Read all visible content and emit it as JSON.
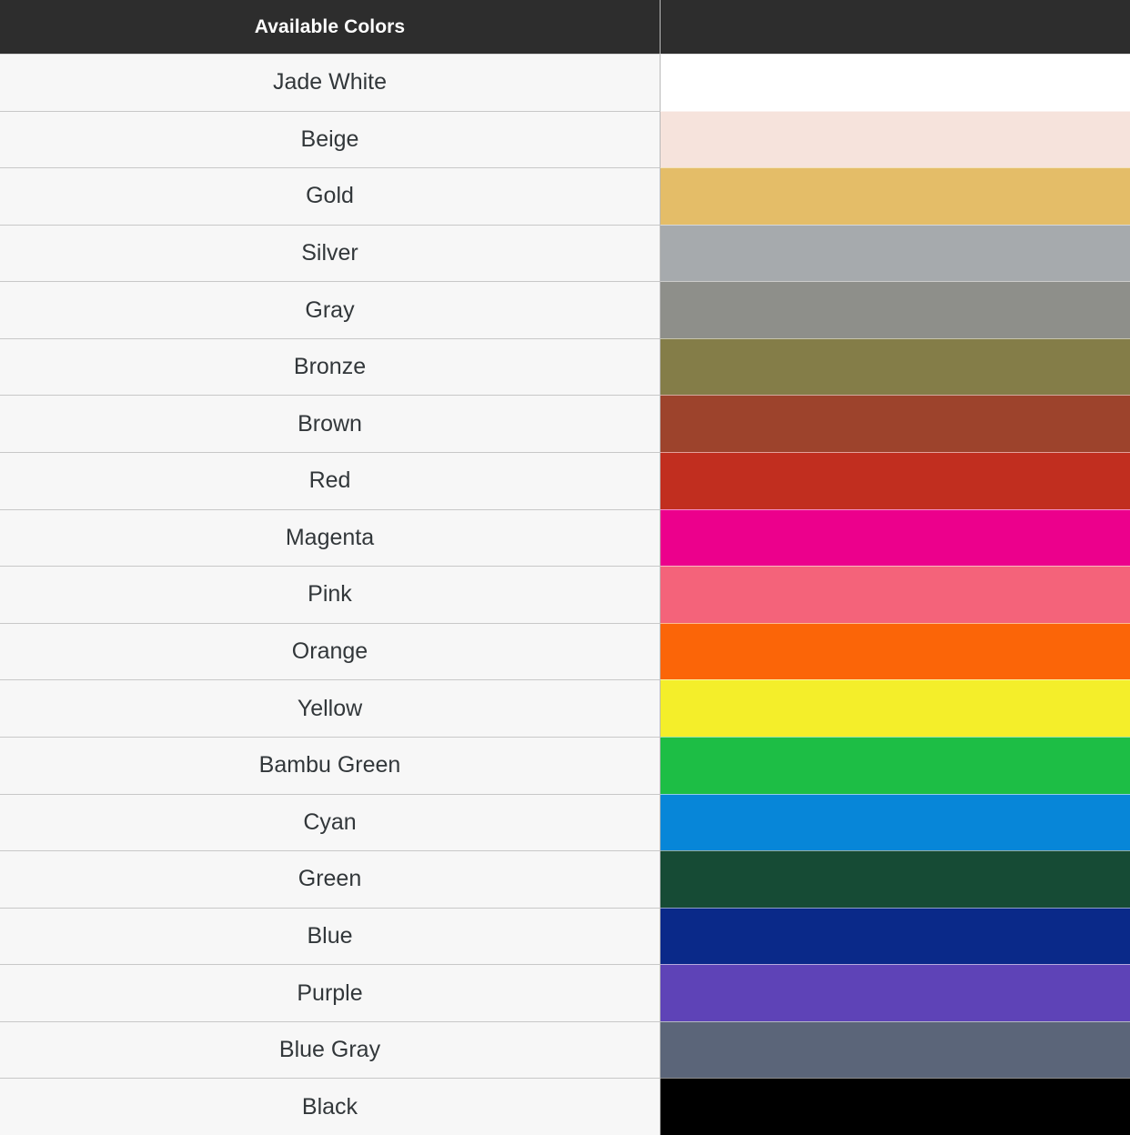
{
  "table": {
    "header": {
      "name_column_label": "Available Colors",
      "swatch_column_label": "",
      "background": "#2d2d2d",
      "text_color": "#ffffff"
    },
    "name_column_background": "#f7f7f7",
    "name_text_color": "#32373a",
    "divider_color": "#c8c8c8",
    "rows": [
      {
        "name": "Jade White",
        "swatch": "#ffffff"
      },
      {
        "name": "Beige",
        "swatch": "#f6e3dc"
      },
      {
        "name": "Gold",
        "swatch": "#e4bd68"
      },
      {
        "name": "Silver",
        "swatch": "#a6aaad"
      },
      {
        "name": "Gray",
        "swatch": "#8e8f8a"
      },
      {
        "name": "Bronze",
        "swatch": "#847d48"
      },
      {
        "name": "Brown",
        "swatch": "#9d432c"
      },
      {
        "name": "Red",
        "swatch": "#c12e1f"
      },
      {
        "name": "Magenta",
        "swatch": "#ec008c"
      },
      {
        "name": "Pink",
        "swatch": "#f4637a"
      },
      {
        "name": "Orange",
        "swatch": "#fb6508"
      },
      {
        "name": "Yellow",
        "swatch": "#f4ee2a"
      },
      {
        "name": "Bambu Green",
        "swatch": "#1dbe45"
      },
      {
        "name": "Cyan",
        "swatch": "#0786d8"
      },
      {
        "name": "Green",
        "swatch": "#164b35"
      },
      {
        "name": "Blue",
        "swatch": "#0a2989"
      },
      {
        "name": "Purple",
        "swatch": "#5e43b7"
      },
      {
        "name": "Blue Gray",
        "swatch": "#5b6579"
      },
      {
        "name": "Black",
        "swatch": "#000000"
      }
    ]
  }
}
